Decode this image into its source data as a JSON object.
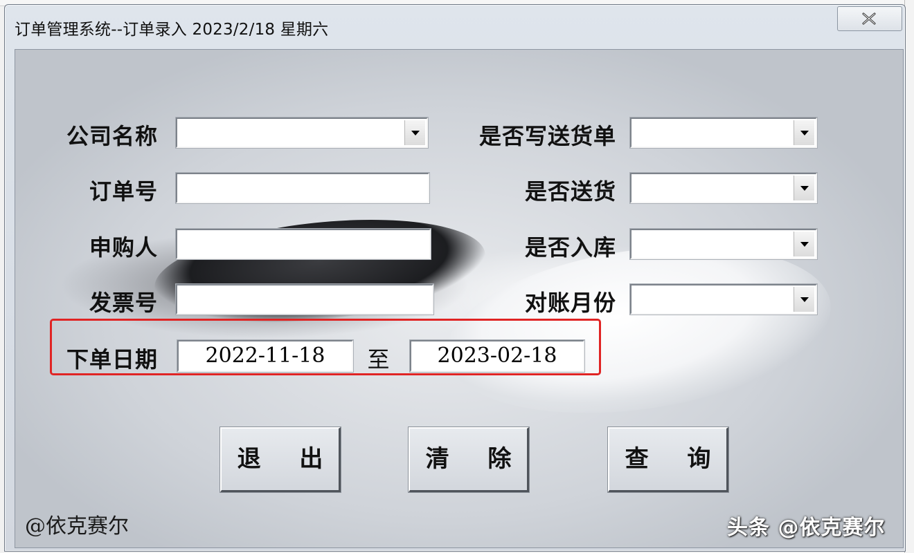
{
  "window": {
    "title": "订单管理系统--订单录入 2023/2/18 星期六",
    "close_icon": "close-icon"
  },
  "form": {
    "company_name": {
      "label": "公司名称",
      "value": ""
    },
    "order_no": {
      "label": "订单号",
      "value": ""
    },
    "requester": {
      "label": "申购人",
      "value": ""
    },
    "invoice_no": {
      "label": "发票号",
      "value": ""
    },
    "delivery_note": {
      "label": "是否写送货单",
      "value": ""
    },
    "delivered": {
      "label": "是否送货",
      "value": ""
    },
    "stocked": {
      "label": "是否入库",
      "value": ""
    },
    "reconcile_month": {
      "label": "对账月份",
      "value": ""
    },
    "order_date": {
      "label": "下单日期",
      "from": "2022-11-18",
      "to_label": "至",
      "to": "2023-02-18"
    }
  },
  "buttons": {
    "exit": "退 出",
    "clear": "清 除",
    "query": "查 询"
  },
  "watermarks": {
    "left": "@依克赛尔",
    "right": "头条 @依克赛尔"
  },
  "colors": {
    "highlight": "#e02424"
  }
}
